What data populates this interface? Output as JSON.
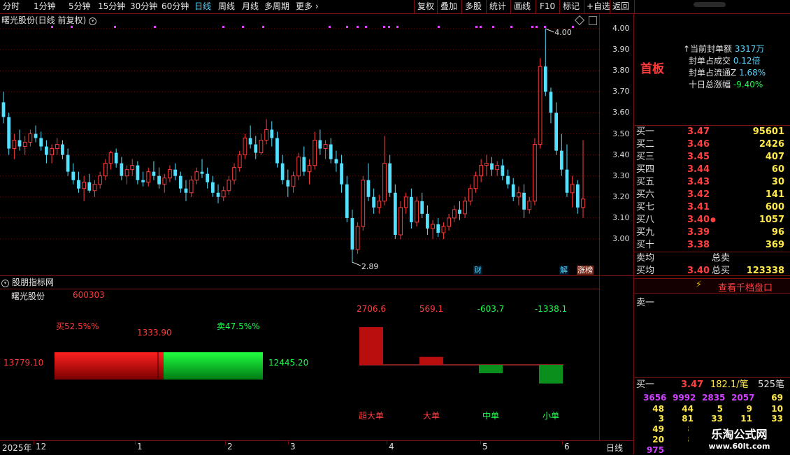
{
  "toolbar": {
    "left_items": [
      "分时",
      "1分钟",
      "5分钟",
      "15分钟",
      "30分钟",
      "60分钟",
      "日线",
      "周线",
      "月线",
      "多周期",
      "更多"
    ],
    "active": "日线",
    "right_items": [
      "复权",
      "叠加",
      "多股",
      "统计",
      "画线",
      "F10",
      "标记",
      "+自选",
      "返回"
    ]
  },
  "chart": {
    "title": "曙光股份(日线 前复权)",
    "y_ticks": [
      "4.00",
      "3.90",
      "3.80",
      "3.70",
      "3.60",
      "3.50",
      "3.40",
      "3.30",
      "3.20",
      "3.10",
      "3.00"
    ],
    "high_label": "4.00",
    "low_label": "2.89",
    "tags": {
      "cai": "财",
      "jie": "解",
      "zhangbang": "涨榜"
    },
    "colors": {
      "up": "#ff3b3b",
      "down": "#54e1ff",
      "marker": "#e040ff"
    }
  },
  "chart_data": {
    "type": "candlestick",
    "title": "曙光股份(日线 前复权)",
    "ylim": [
      2.85,
      4.05
    ],
    "annotations": [
      {
        "text": "4.00",
        "value": 4.0
      },
      {
        "text": "2.89",
        "value": 2.89
      }
    ],
    "candles": [
      [
        3.65,
        3.7,
        3.55,
        3.58
      ],
      [
        3.58,
        3.6,
        3.4,
        3.43
      ],
      [
        3.43,
        3.5,
        3.38,
        3.47
      ],
      [
        3.47,
        3.52,
        3.42,
        3.44
      ],
      [
        3.44,
        3.49,
        3.4,
        3.46
      ],
      [
        3.46,
        3.52,
        3.44,
        3.5
      ],
      [
        3.5,
        3.54,
        3.46,
        3.48
      ],
      [
        3.48,
        3.51,
        3.42,
        3.44
      ],
      [
        3.44,
        3.47,
        3.36,
        3.4
      ],
      [
        3.4,
        3.45,
        3.36,
        3.43
      ],
      [
        3.43,
        3.48,
        3.4,
        3.45
      ],
      [
        3.45,
        3.47,
        3.38,
        3.4
      ],
      [
        3.4,
        3.43,
        3.3,
        3.32
      ],
      [
        3.32,
        3.36,
        3.26,
        3.28
      ],
      [
        3.28,
        3.32,
        3.22,
        3.24
      ],
      [
        3.24,
        3.3,
        3.18,
        3.27
      ],
      [
        3.27,
        3.31,
        3.22,
        3.23
      ],
      [
        3.23,
        3.28,
        3.2,
        3.26
      ],
      [
        3.26,
        3.32,
        3.24,
        3.3
      ],
      [
        3.3,
        3.38,
        3.28,
        3.36
      ],
      [
        3.36,
        3.42,
        3.33,
        3.41
      ],
      [
        3.41,
        3.43,
        3.34,
        3.36
      ],
      [
        3.36,
        3.39,
        3.28,
        3.3
      ],
      [
        3.3,
        3.35,
        3.26,
        3.33
      ],
      [
        3.33,
        3.38,
        3.3,
        3.35
      ],
      [
        3.35,
        3.37,
        3.26,
        3.28
      ],
      [
        3.28,
        3.32,
        3.25,
        3.27
      ],
      [
        3.27,
        3.34,
        3.25,
        3.32
      ],
      [
        3.32,
        3.37,
        3.28,
        3.3
      ],
      [
        3.3,
        3.34,
        3.24,
        3.26
      ],
      [
        3.26,
        3.31,
        3.22,
        3.29
      ],
      [
        3.29,
        3.35,
        3.27,
        3.33
      ],
      [
        3.33,
        3.36,
        3.28,
        3.3
      ],
      [
        3.3,
        3.32,
        3.22,
        3.24
      ],
      [
        3.24,
        3.28,
        3.18,
        3.22
      ],
      [
        3.22,
        3.3,
        3.2,
        3.28
      ],
      [
        3.28,
        3.34,
        3.26,
        3.32
      ],
      [
        3.32,
        3.38,
        3.29,
        3.31
      ],
      [
        3.31,
        3.34,
        3.24,
        3.27
      ],
      [
        3.27,
        3.3,
        3.2,
        3.22
      ],
      [
        3.22,
        3.26,
        3.17,
        3.2
      ],
      [
        3.2,
        3.25,
        3.18,
        3.23
      ],
      [
        3.23,
        3.3,
        3.21,
        3.28
      ],
      [
        3.28,
        3.36,
        3.26,
        3.34
      ],
      [
        3.34,
        3.42,
        3.32,
        3.4
      ],
      [
        3.4,
        3.5,
        3.38,
        3.48
      ],
      [
        3.48,
        3.54,
        3.43,
        3.45
      ],
      [
        3.45,
        3.49,
        3.38,
        3.41
      ],
      [
        3.41,
        3.5,
        3.4,
        3.47
      ],
      [
        3.47,
        3.57,
        3.45,
        3.52
      ],
      [
        3.52,
        3.56,
        3.44,
        3.48
      ],
      [
        3.48,
        3.51,
        3.34,
        3.36
      ],
      [
        3.36,
        3.4,
        3.26,
        3.28
      ],
      [
        3.28,
        3.33,
        3.2,
        3.25
      ],
      [
        3.25,
        3.32,
        3.22,
        3.3
      ],
      [
        3.3,
        3.41,
        3.28,
        3.39
      ],
      [
        3.39,
        3.44,
        3.3,
        3.32
      ],
      [
        3.32,
        3.38,
        3.26,
        3.35
      ],
      [
        3.35,
        3.51,
        3.33,
        3.47
      ],
      [
        3.47,
        3.52,
        3.4,
        3.43
      ],
      [
        3.43,
        3.47,
        3.38,
        3.45
      ],
      [
        3.45,
        3.48,
        3.36,
        3.38
      ],
      [
        3.38,
        3.42,
        3.32,
        3.36
      ],
      [
        3.36,
        3.4,
        3.22,
        3.26
      ],
      [
        3.26,
        3.3,
        3.08,
        3.1
      ],
      [
        3.1,
        3.14,
        2.89,
        2.95
      ],
      [
        2.95,
        3.08,
        2.93,
        3.06
      ],
      [
        3.06,
        3.3,
        3.04,
        3.28
      ],
      [
        3.28,
        3.36,
        3.18,
        3.2
      ],
      [
        3.2,
        3.24,
        3.12,
        3.15
      ],
      [
        3.15,
        3.21,
        3.12,
        3.18
      ],
      [
        3.18,
        3.49,
        3.16,
        3.36
      ],
      [
        3.36,
        3.4,
        3.2,
        3.22
      ],
      [
        3.22,
        3.26,
        3.0,
        3.02
      ],
      [
        3.02,
        3.18,
        3.0,
        3.15
      ],
      [
        3.15,
        3.22,
        3.12,
        3.2
      ],
      [
        3.2,
        3.24,
        3.05,
        3.08
      ],
      [
        3.08,
        3.2,
        3.06,
        3.18
      ],
      [
        3.18,
        3.22,
        3.1,
        3.12
      ],
      [
        3.12,
        3.16,
        3.02,
        3.05
      ],
      [
        3.05,
        3.09,
        3.0,
        3.07
      ],
      [
        3.07,
        3.1,
        3.01,
        3.03
      ],
      [
        3.03,
        3.08,
        3.0,
        3.06
      ],
      [
        3.06,
        3.12,
        3.04,
        3.1
      ],
      [
        3.1,
        3.16,
        3.08,
        3.14
      ],
      [
        3.14,
        3.18,
        3.09,
        3.12
      ],
      [
        3.12,
        3.2,
        3.1,
        3.18
      ],
      [
        3.18,
        3.26,
        3.16,
        3.24
      ],
      [
        3.24,
        3.32,
        3.22,
        3.3
      ],
      [
        3.3,
        3.38,
        3.27,
        3.35
      ],
      [
        3.35,
        3.4,
        3.3,
        3.36
      ],
      [
        3.36,
        3.39,
        3.3,
        3.33
      ],
      [
        3.33,
        3.37,
        3.3,
        3.35
      ],
      [
        3.35,
        3.38,
        3.28,
        3.3
      ],
      [
        3.3,
        3.33,
        3.24,
        3.26
      ],
      [
        3.26,
        3.29,
        3.18,
        3.2
      ],
      [
        3.2,
        3.25,
        3.16,
        3.22
      ],
      [
        3.22,
        3.26,
        3.1,
        3.14
      ],
      [
        3.14,
        3.2,
        3.12,
        3.18
      ],
      [
        3.18,
        3.48,
        3.16,
        3.45
      ],
      [
        3.45,
        3.86,
        3.43,
        3.82
      ],
      [
        3.82,
        4.0,
        3.68,
        3.7
      ],
      [
        3.7,
        3.72,
        3.55,
        3.6
      ],
      [
        3.6,
        3.65,
        3.4,
        3.42
      ],
      [
        3.42,
        3.5,
        3.3,
        3.33
      ],
      [
        3.33,
        3.45,
        3.2,
        3.22
      ],
      [
        3.22,
        3.3,
        3.15,
        3.26
      ],
      [
        3.26,
        3.28,
        3.12,
        3.15
      ],
      [
        3.15,
        3.47,
        3.1,
        3.19
      ]
    ],
    "sub_chart": {
      "type": "bar",
      "categories": [
        "超大单",
        "大单",
        "中单",
        "小单"
      ],
      "values": [
        2706.6,
        569.1,
        -603.7,
        -1338.1
      ]
    }
  },
  "indicator": {
    "panel_title": "股朋指标网",
    "stock_name": "曙光股份",
    "stock_code": "600303",
    "buy_pct": "买52.5%%",
    "sell_pct": "卖47.5%%",
    "mid_value": "1333.90",
    "buy_total": "13779.10",
    "sell_total": "12445.20",
    "buy_ratio": 0.525,
    "flow_labels": [
      "超大单",
      "大单",
      "中单",
      "小单"
    ],
    "flow_values": [
      "2706.6",
      "569.1",
      "-603.7",
      "-1338.1"
    ],
    "flow_numbers": [
      2706.6,
      569.1,
      -603.7,
      -1338.1
    ]
  },
  "timeline": {
    "labels": [
      "2025年",
      "12",
      "1",
      "2",
      "3",
      "4",
      "5",
      "6"
    ],
    "period_label": "日线"
  },
  "right_panel": {
    "board": "首板",
    "stats": [
      {
        "label": "当前封单额",
        "value": "3317万",
        "neg": false
      },
      {
        "label": "封单占成交",
        "value": "0.12倍",
        "neg": false
      },
      {
        "label": "封单占流通Z",
        "value": "1.68%",
        "neg": false
      },
      {
        "label": "十日总涨幅",
        "value": "-9.40%",
        "neg": true
      }
    ],
    "bids": [
      {
        "name": "买一",
        "price": "3.47",
        "vol": "95601"
      },
      {
        "name": "买二",
        "price": "3.46",
        "vol": "2426"
      },
      {
        "name": "买三",
        "price": "3.45",
        "vol": "407"
      },
      {
        "name": "买四",
        "price": "3.44",
        "vol": "60"
      },
      {
        "name": "买五",
        "price": "3.43",
        "vol": "30"
      },
      {
        "name": "买六",
        "price": "3.42",
        "vol": "141"
      },
      {
        "name": "买七",
        "price": "3.41",
        "vol": "600"
      },
      {
        "name": "买八",
        "price": "3.40",
        "vol": "1057"
      },
      {
        "name": "买九",
        "price": "3.39",
        "vol": "96"
      },
      {
        "name": "买十",
        "price": "3.38",
        "vol": "369"
      }
    ],
    "sell_avg_label": "卖均",
    "total_sell_label": "总卖",
    "buy_avg_label": "买均",
    "buy_avg_price": "3.40",
    "total_buy_label": "总买",
    "total_buy": "123338",
    "view_1000": "查看千档盘口",
    "sell1_label": "卖一",
    "buy1_label": "买一",
    "buy1_price": "3.47",
    "buy1_avg": "182.1/笔",
    "buy1_count": "525笔",
    "queue_row1": [
      "3656",
      "9992",
      "2835",
      "2057",
      "69"
    ],
    "queue_row2": [
      "48",
      "44",
      "5",
      "9",
      "10"
    ],
    "queue_row3": [
      "3",
      "81",
      "33",
      "11",
      "33"
    ],
    "queue_row4": [
      "49",
      "8"
    ],
    "queue_row5": [
      "20",
      "8"
    ],
    "queue_row6": [
      "975"
    ]
  },
  "watermark": {
    "line1": "乐淘公式网",
    "line2": "www.60lt.com"
  }
}
